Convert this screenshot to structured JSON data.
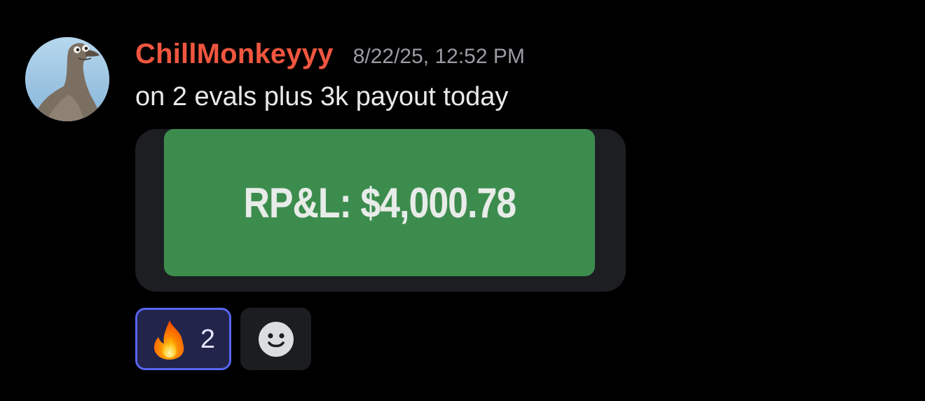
{
  "message": {
    "author": "ChillMonkeyyy",
    "timestamp": "8/22/25, 12:52 PM",
    "content": "on 2 evals plus 3k payout today",
    "avatar_icon": "seagull-avatar",
    "author_color": "#f0563f"
  },
  "attachment": {
    "text": "RP&L: $4,000.78",
    "card_color": "#3c8c4e"
  },
  "reactions": [
    {
      "emoji_icon": "fire-emoji",
      "count": "2",
      "active": true
    }
  ],
  "add_reaction_icon": "smiley-icon"
}
